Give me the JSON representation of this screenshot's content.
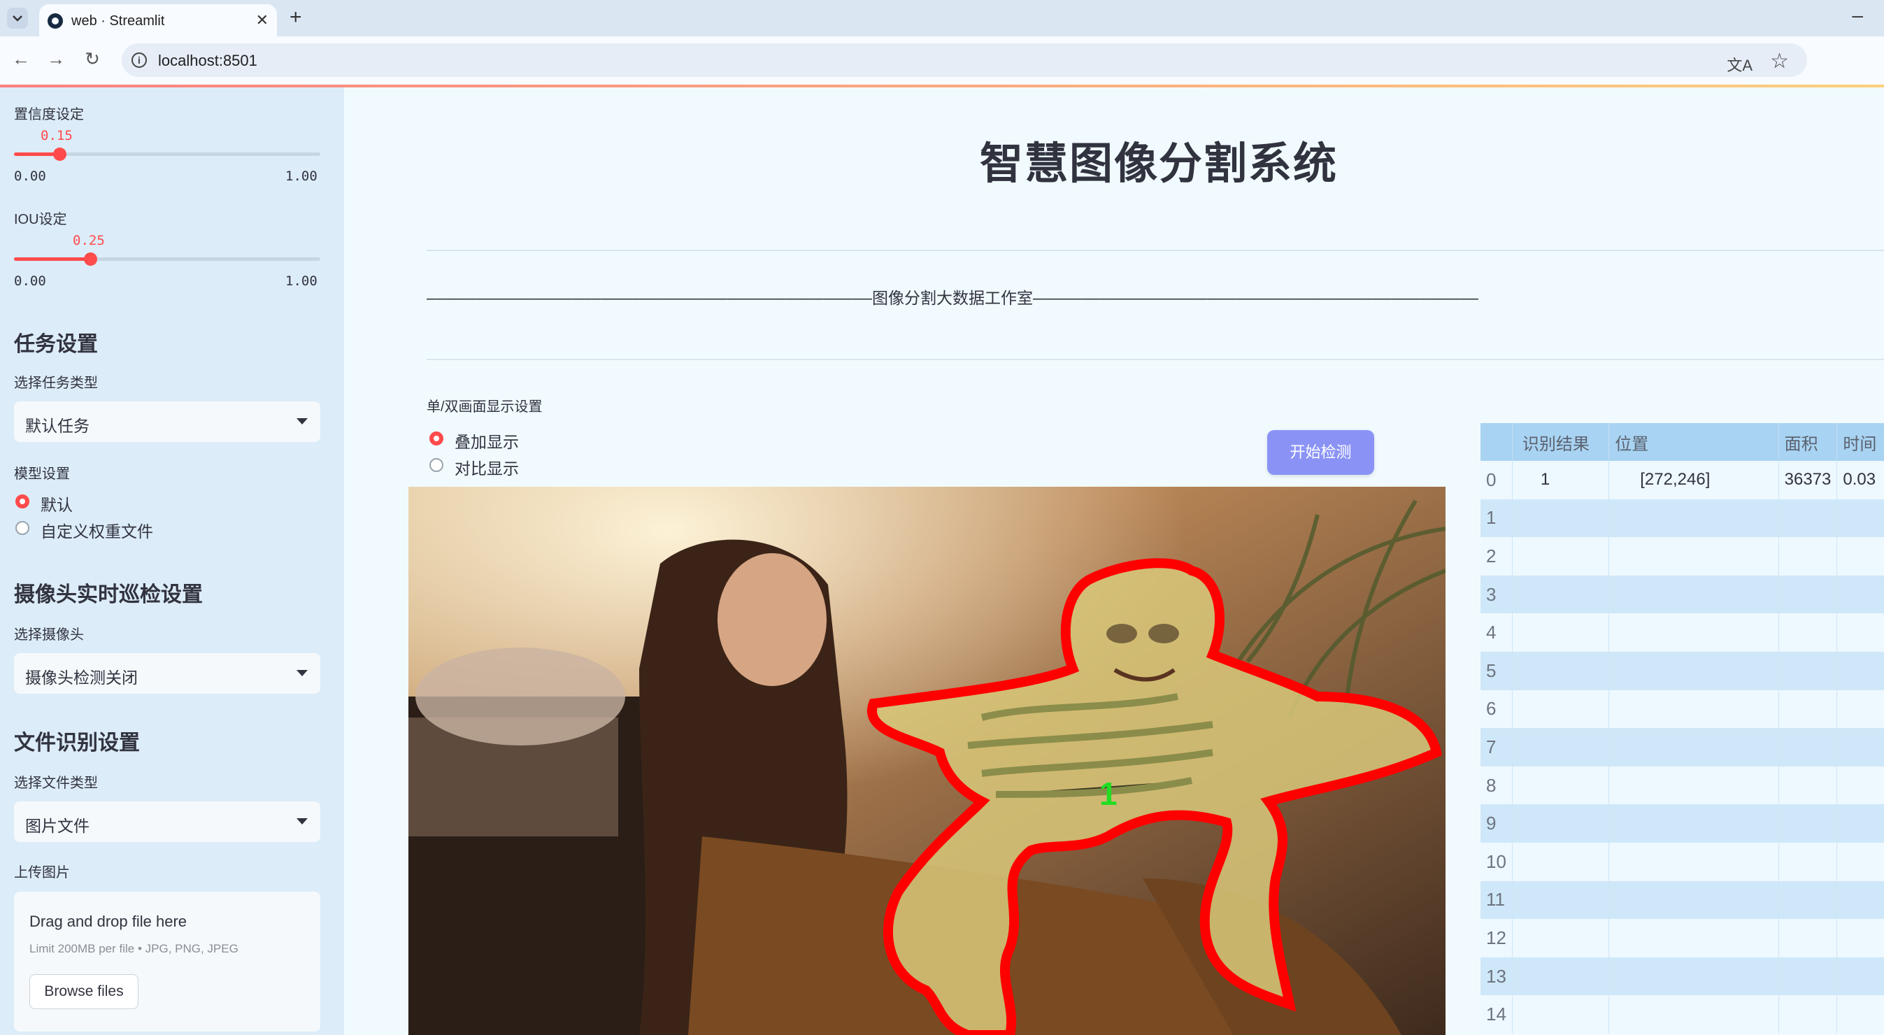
{
  "browser": {
    "tab_title": "web · Streamlit",
    "url": "localhost:8501"
  },
  "sidebar": {
    "confidence": {
      "label": "置信度设定",
      "value_text": "0.15",
      "value": 0.15,
      "min": "0.00",
      "max": "1.00"
    },
    "iou": {
      "label": "IOU设定",
      "value_text": "0.25",
      "value": 0.25,
      "min": "0.00",
      "max": "1.00"
    },
    "task": {
      "heading": "任务设置",
      "select_label": "选择任务类型",
      "selected": "默认任务"
    },
    "model": {
      "label": "模型设置",
      "options": [
        "默认",
        "自定义权重文件"
      ],
      "selected_index": 0
    },
    "camera": {
      "heading": "摄像头实时巡检设置",
      "select_label": "选择摄像头",
      "selected": "摄像头检测关闭"
    },
    "file": {
      "heading": "文件识别设置",
      "select_label": "选择文件类型",
      "selected": "图片文件",
      "upload_label": "上传图片"
    },
    "uploader": {
      "title": "Drag and drop file here",
      "limit": "Limit 200MB per file • JPG, PNG, JPEG",
      "button": "Browse files"
    }
  },
  "main": {
    "title": "智慧图像分割系统",
    "banner": "——————————————————————————————————————————————图像分割大数据工作室——————————————————————————————————————————————",
    "display_mode": {
      "label": "单/双画面显示设置",
      "options": [
        "叠加显示",
        "对比显示"
      ],
      "selected_index": 0
    },
    "detect_button": "开始检测",
    "detection_label": "1"
  },
  "results_table": {
    "columns": [
      "",
      "识别结果",
      "位置",
      "面积",
      "时间"
    ],
    "rows": [
      [
        "0",
        "1",
        "[272,246]",
        "36373",
        "0.03"
      ],
      [
        "1",
        "",
        "",
        "",
        ""
      ],
      [
        "2",
        "",
        "",
        "",
        ""
      ],
      [
        "3",
        "",
        "",
        "",
        ""
      ],
      [
        "4",
        "",
        "",
        "",
        ""
      ],
      [
        "5",
        "",
        "",
        "",
        ""
      ],
      [
        "6",
        "",
        "",
        "",
        ""
      ],
      [
        "7",
        "",
        "",
        "",
        ""
      ],
      [
        "8",
        "",
        "",
        "",
        ""
      ],
      [
        "9",
        "",
        "",
        "",
        ""
      ],
      [
        "10",
        "",
        "",
        "",
        ""
      ],
      [
        "11",
        "",
        "",
        "",
        ""
      ],
      [
        "12",
        "",
        "",
        "",
        ""
      ],
      [
        "13",
        "",
        "",
        "",
        ""
      ],
      [
        "14",
        "",
        "",
        "",
        ""
      ]
    ]
  },
  "colors": {
    "accent": "#ff4b4b",
    "button": "#8a93f5",
    "mask_outline": "#ff0000",
    "mask_fill": "#d9c87a",
    "sidebar_bg": "#dcecf8"
  }
}
